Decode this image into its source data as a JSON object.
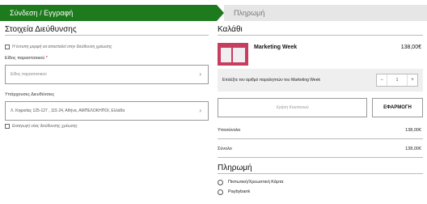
{
  "steps": {
    "current": "Σύνδεση / Εγγραφή",
    "next": "Πληρωμή"
  },
  "address": {
    "title": "Στοιχεία Διεύθυνσης",
    "printed_checkbox_label": "Η έντυπη μορφή να αποσταλεί στην διεύθυνση χρέωσης",
    "type_label": "Είδος παραστατικού",
    "required_mark": "*",
    "type_placeholder": "Είδος παραστατικού",
    "existing_label": "Υπάρχουσες Διευθύνσεις",
    "existing_value": "Λ. Κηφισίας 125-127 , 115 24, Αθήνα, ΑΜΠΕΛΟΚΗΠΟΙ, Ελλάδα",
    "new_address_label": "Εισαγωγή νέας διεύθυνσης χρέωσης"
  },
  "cart": {
    "title": "Καλάθι",
    "item": {
      "name": "Marketing Week",
      "price": "138,00€"
    },
    "quantity_label": "Επιλέξτε τον αριθμό παραληπτών του Marketing Week",
    "quantity": "1",
    "minus": "−",
    "plus": "+",
    "coupon_placeholder": "Χρήση Κουπονιού",
    "apply_label": "ΕΦΑΡΜΟΓΗ",
    "subtotal_label": "Υποσύνολο",
    "subtotal": "138,00€",
    "total_label": "Σύνολο",
    "total": "138,00€"
  },
  "payment": {
    "title": "Πληρωμή",
    "options": [
      "Πιστωτική/Χρεωστική Κάρτα",
      "Paybybank"
    ]
  },
  "colors": {
    "accent": "#1d7a1d",
    "thumb": "#c73d5f",
    "step_inactive": "#e6e6e6"
  }
}
